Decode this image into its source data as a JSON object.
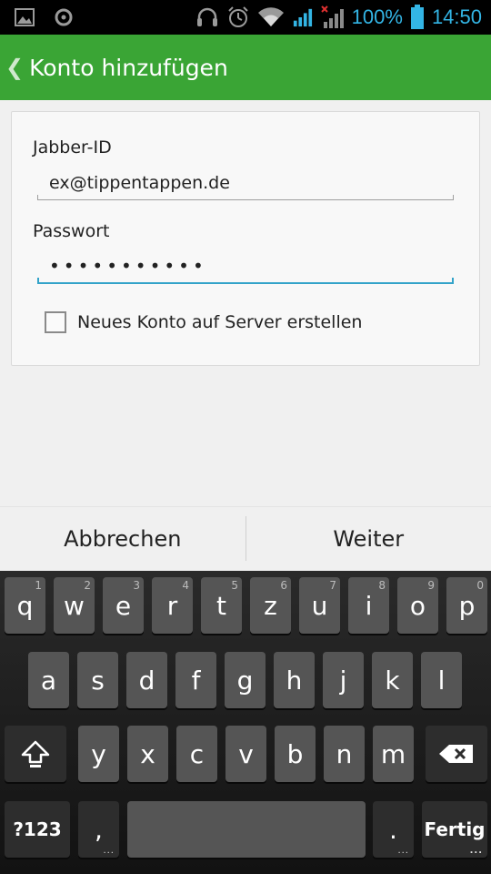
{
  "status_bar": {
    "battery_percent": "100%",
    "time": "14:50",
    "icons_left": [
      "image-icon",
      "circle-record-icon"
    ],
    "icons_right": [
      "headset-icon",
      "alarm-icon",
      "wifi-icon",
      "signal-icon",
      "signal-no-service-icon",
      "battery-icon"
    ],
    "accent_color": "#33b5e5"
  },
  "action_bar": {
    "title": "Konto hinzufügen",
    "back_icon": "chevron-left-icon",
    "color": "#3aa535"
  },
  "form": {
    "jabber_label": "Jabber-ID",
    "jabber_value": "ex@tippentappen.de",
    "password_label": "Passwort",
    "password_mask": "•••••••••••",
    "checkbox_label": "Neues Konto auf Server erstellen",
    "checkbox_checked": false
  },
  "buttons": {
    "cancel": "Abbrechen",
    "next": "Weiter"
  },
  "keyboard": {
    "row1": [
      {
        "k": "q",
        "h": "1"
      },
      {
        "k": "w",
        "h": "2"
      },
      {
        "k": "e",
        "h": "3"
      },
      {
        "k": "r",
        "h": "4"
      },
      {
        "k": "t",
        "h": "5"
      },
      {
        "k": "z",
        "h": "6"
      },
      {
        "k": "u",
        "h": "7"
      },
      {
        "k": "i",
        "h": "8"
      },
      {
        "k": "o",
        "h": "9"
      },
      {
        "k": "p",
        "h": "0"
      }
    ],
    "row2": [
      "a",
      "s",
      "d",
      "f",
      "g",
      "h",
      "j",
      "k",
      "l"
    ],
    "row3": [
      "y",
      "x",
      "c",
      "v",
      "b",
      "n",
      "m"
    ],
    "sym": "?123",
    "comma": ",",
    "period": ".",
    "done": "Fertig",
    "more_dots": "..."
  }
}
